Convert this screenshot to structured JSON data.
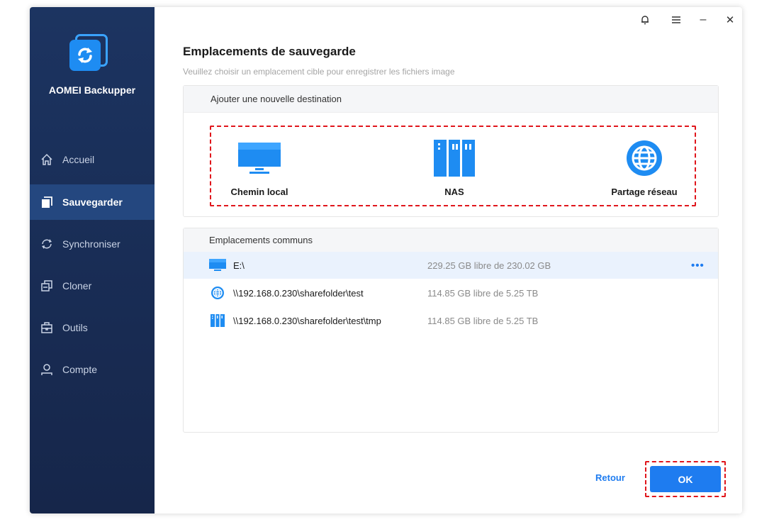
{
  "app": {
    "name": "AOMEI Backupper"
  },
  "sidebar": {
    "items": [
      {
        "label": "Accueil",
        "icon": "home-icon",
        "active": false
      },
      {
        "label": "Sauvegarder",
        "icon": "backup-icon",
        "active": true
      },
      {
        "label": "Synchroniser",
        "icon": "sync-icon",
        "active": false
      },
      {
        "label": "Cloner",
        "icon": "clone-icon",
        "active": false
      },
      {
        "label": "Outils",
        "icon": "tools-icon",
        "active": false
      },
      {
        "label": "Compte",
        "icon": "account-icon",
        "active": false
      }
    ]
  },
  "titlebar": {
    "icons": [
      "bell-icon",
      "menu-icon",
      "minimize-icon",
      "close-icon"
    ],
    "minimize_glyph": "–",
    "close_glyph": "✕"
  },
  "main": {
    "title": "Emplacements de sauvegarde",
    "subtitle": "Veuillez choisir un emplacement cible pour enregistrer les fichiers image"
  },
  "new_destination": {
    "header": "Ajouter une nouvelle destination",
    "options": [
      {
        "label": "Chemin local",
        "icon": "monitor-icon"
      },
      {
        "label": "NAS",
        "icon": "nas-icon"
      },
      {
        "label": "Partage réseau",
        "icon": "globe-icon"
      }
    ]
  },
  "common_locations": {
    "header": "Emplacements communs",
    "rows": [
      {
        "icon": "monitor-icon",
        "path": "E:\\",
        "free": "229.25 GB libre de 230.02 GB",
        "selected": true,
        "more": "•••"
      },
      {
        "icon": "globe-icon",
        "path": "\\\\192.168.0.230\\sharefolder\\test",
        "free": "114.85 GB libre de 5.25 TB",
        "selected": false
      },
      {
        "icon": "nas-icon",
        "path": "\\\\192.168.0.230\\sharefolder\\test\\tmp",
        "free": "114.85 GB libre de 5.25 TB",
        "selected": false
      }
    ]
  },
  "footer": {
    "back_label": "Retour",
    "ok_label": "OK"
  },
  "colors": {
    "sidebar": "#1c3461",
    "sidebar_active": "#24477f",
    "accent": "#1e7cf0",
    "highlight": "#e0161c"
  }
}
